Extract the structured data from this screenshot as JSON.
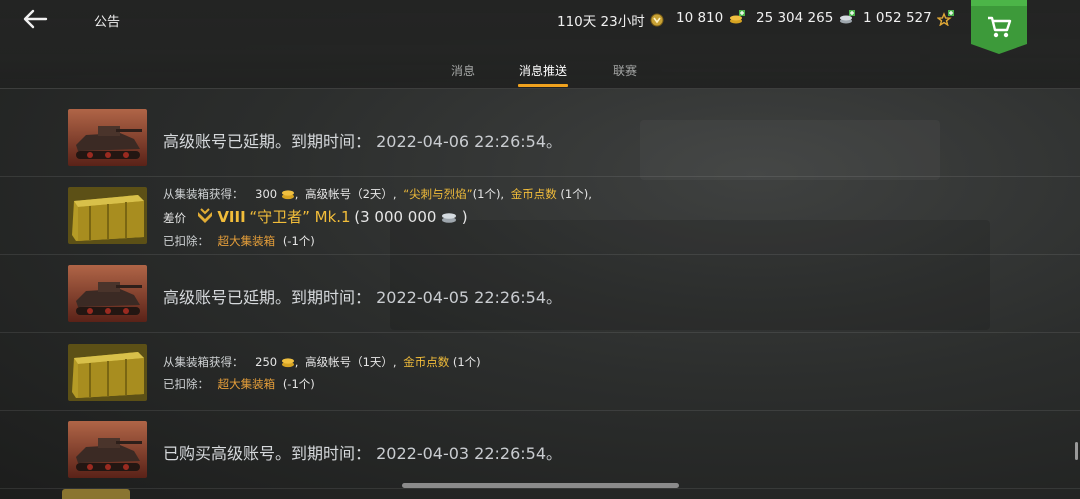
{
  "header": {
    "title": "公告",
    "premium_time": "110天 23小时",
    "gold": "10 810",
    "credits": "25 304 265",
    "free_xp": "1 052 527"
  },
  "tabs": [
    {
      "label": "消息"
    },
    {
      "label": "消息推送"
    },
    {
      "label": "联赛"
    }
  ],
  "notifications": [
    {
      "type": "premium",
      "text": "高级账号已延期。到期时间：",
      "time": "2022-04-06 22:26:54。"
    },
    {
      "type": "container",
      "from": "从集装箱获得：",
      "gold_amount": "300",
      "sep1": ",",
      "premium": "高级帐号（2天）,",
      "style_name": "“尖刺与烈焰”",
      "style_count": "(1个),",
      "points_name": "金币点数",
      "points_count": "(1个),",
      "diff_label": "差价",
      "tank_tier": "VIII",
      "tank_name": "“守卫者” Mk.1",
      "tank_value_open": "(3 000 000",
      "tank_value_close": ")",
      "deducted_label": "已扣除：",
      "deducted_item": "超大集装箱",
      "deducted_count": "(-1个)"
    },
    {
      "type": "premium",
      "text": "高级账号已延期。到期时间：",
      "time": "2022-04-05 22:26:54。"
    },
    {
      "type": "container",
      "from": "从集装箱获得：",
      "gold_amount": "250",
      "sep1": ",",
      "premium": "高级帐号（1天）,",
      "points_name": "金币点数",
      "points_count": "(1个)",
      "deducted_label": "已扣除：",
      "deducted_item": "超大集装箱",
      "deducted_count": "(-1个)"
    },
    {
      "type": "premium",
      "text": "已购买高级账号。到期时间：",
      "time": "2022-04-03 22:26:54。"
    }
  ],
  "colors": {
    "accent": "#f0a21e",
    "gold_text": "#f2bd3a",
    "cart": "#3d9a3a"
  },
  "icons": [
    "back-arrow-icon",
    "premium-badge-icon",
    "gold-coins-icon",
    "credits-coins-icon",
    "star-xp-icon",
    "shopping-cart-icon",
    "tier-chevron-icon"
  ]
}
